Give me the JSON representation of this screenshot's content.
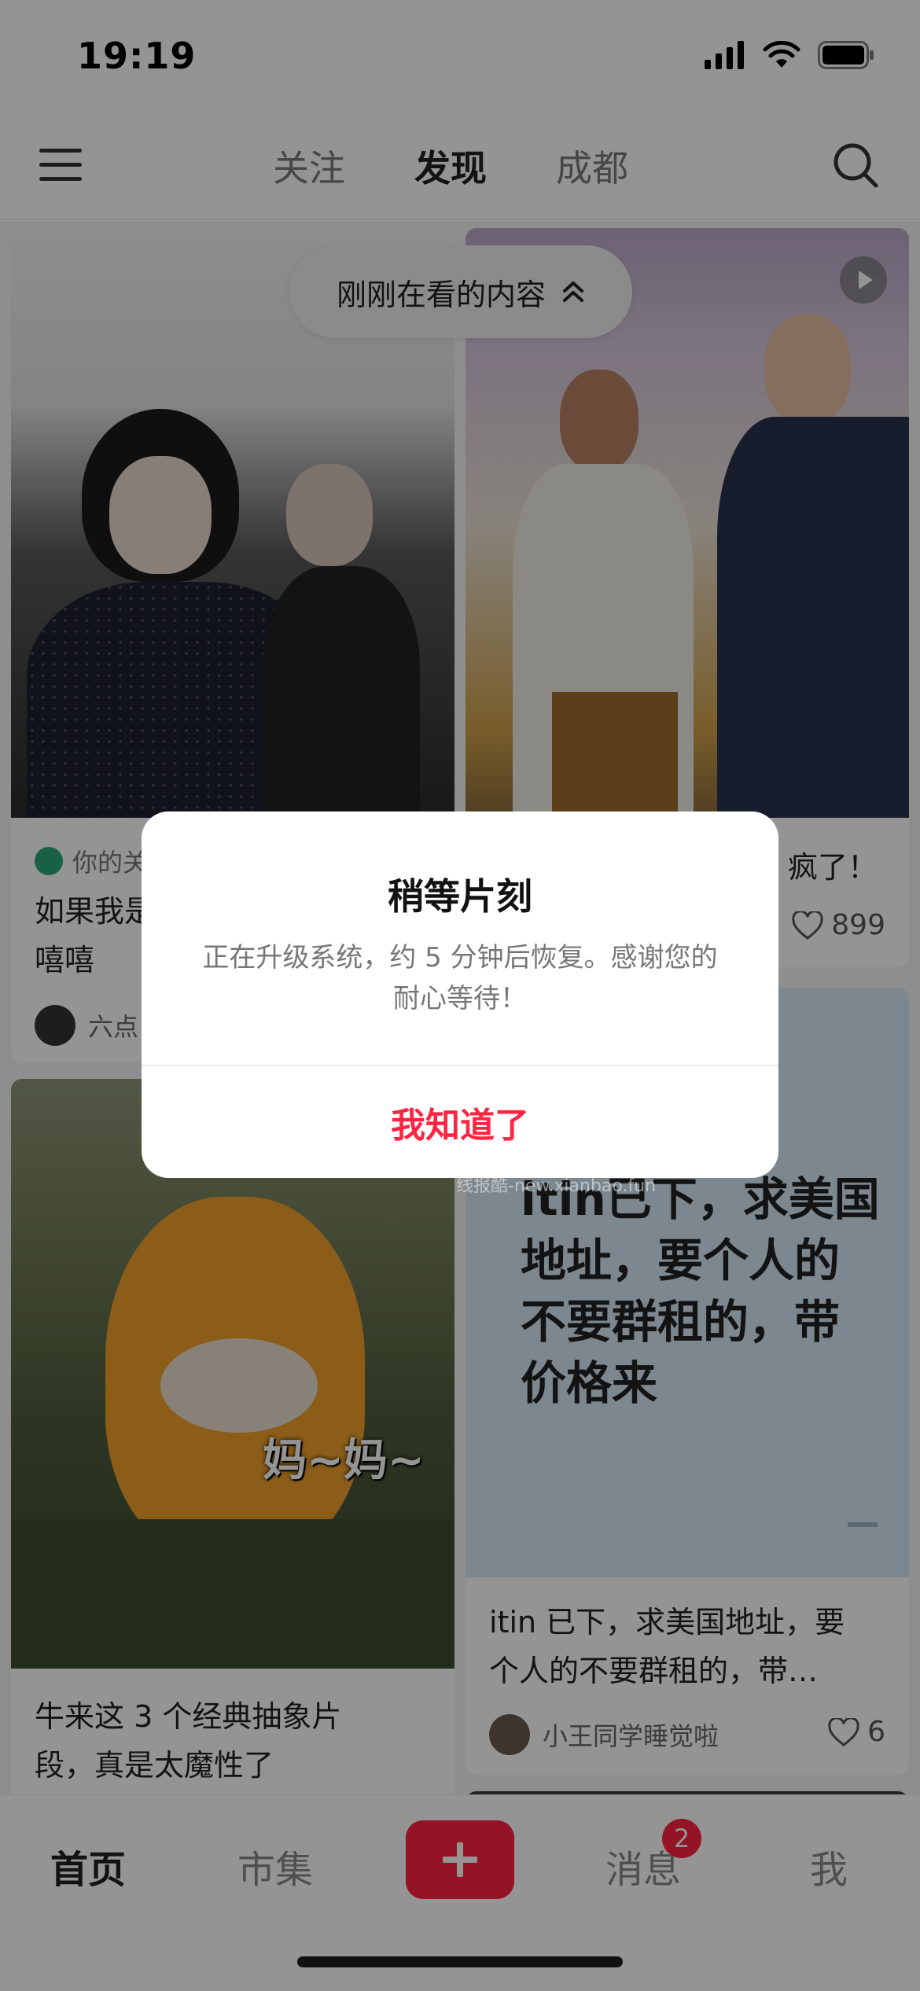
{
  "status_bar": {
    "time": "19:19"
  },
  "header": {
    "tabs": [
      {
        "label": "关注",
        "active": false
      },
      {
        "label": "发现",
        "active": true
      },
      {
        "label": "成都",
        "active": false
      }
    ]
  },
  "pill": {
    "label": "刚刚在看的内容"
  },
  "feed": {
    "cards": [
      {
        "tag": "你的关注",
        "title": "如果我是…嘻嘻",
        "title_line1": "如果我是",
        "title_line2": "嘻嘻",
        "author": "六点"
      },
      {
        "title_tail": "疯了！",
        "likes": "899"
      },
      {
        "title_line1": "牛来这 3 个经典抽象片",
        "title_line2": "段，真是太魔性了",
        "image_caption": "妈~妈~"
      },
      {
        "image_text": [
          "itin已下，求美国",
          "地址，要个人的",
          "不要群租的，带",
          "价格来"
        ],
        "title_line1": "itin 已下，求美国地址，要",
        "title_line2": "个人的不要群租的，带…",
        "author": "小王同学睡觉啦",
        "likes": "6"
      }
    ]
  },
  "modal": {
    "title": "稍等片刻",
    "body": "正在升级系统，约 5 分钟后恢复。感谢您的耐心等待！",
    "action": "我知道了"
  },
  "bottom_nav": {
    "items": [
      "首页",
      "市集",
      "消息",
      "我"
    ],
    "messages_badge": "2"
  },
  "watermark": "线报酷-new.xianbao.fun",
  "colors": {
    "accent": "#ff2442",
    "overlay": "rgba(0,0,0,0.42)"
  }
}
